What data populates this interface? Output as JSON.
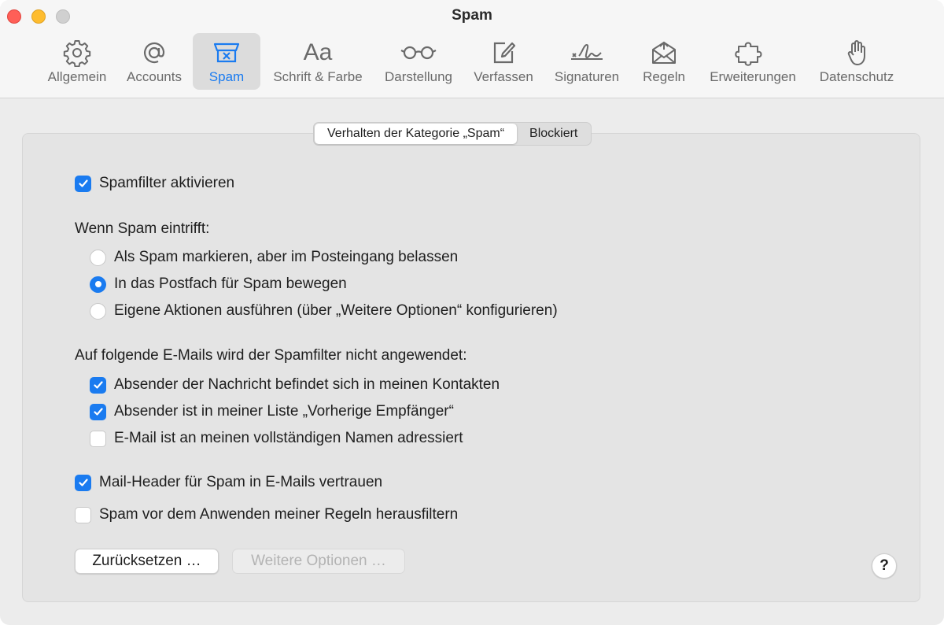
{
  "window": {
    "title": "Spam"
  },
  "toolbar": {
    "items": [
      {
        "label": "Allgemein",
        "icon": "gear-icon"
      },
      {
        "label": "Accounts",
        "icon": "at-sign-icon"
      },
      {
        "label": "Spam",
        "icon": "junk-tray-icon",
        "active": true
      },
      {
        "label": "Schrift & Farbe",
        "icon": "font-aa-icon"
      },
      {
        "label": "Darstellung",
        "icon": "glasses-icon"
      },
      {
        "label": "Verfassen",
        "icon": "compose-icon"
      },
      {
        "label": "Signaturen",
        "icon": "signature-icon"
      },
      {
        "label": "Regeln",
        "icon": "rules-envelope-icon"
      },
      {
        "label": "Erweiterungen",
        "icon": "puzzle-piece-icon"
      },
      {
        "label": "Datenschutz",
        "icon": "hand-icon"
      }
    ]
  },
  "segmented": {
    "tab1": "Verhalten der Kategorie „Spam“",
    "tab2": "Blockiert",
    "selected": "tab1"
  },
  "settings": {
    "enable_filter": {
      "label": "Spamfilter aktivieren",
      "checked": true
    },
    "when_spam_heading": "Wenn Spam eintrifft:",
    "radio_options": [
      {
        "label": "Als Spam markieren, aber im Posteingang belassen",
        "selected": false
      },
      {
        "label": "In das Postfach für Spam bewegen",
        "selected": true
      },
      {
        "label": "Eigene Aktionen ausführen (über „Weitere Optionen“ konfigurieren)",
        "selected": false
      }
    ],
    "exempt_heading": "Auf folgende E-Mails wird der Spamfilter nicht angewendet:",
    "exempt_options": [
      {
        "label": "Absender der Nachricht befindet sich in meinen Kontakten",
        "checked": true
      },
      {
        "label": "Absender ist in meiner Liste „Vorherige Empfänger“",
        "checked": true
      },
      {
        "label": "E-Mail ist an meinen vollständigen Namen adressiert",
        "checked": false
      }
    ],
    "trust_headers": {
      "label": "Mail-Header für Spam in E-Mails vertrauen",
      "checked": true
    },
    "filter_before_rules": {
      "label": "Spam vor dem Anwenden meiner Regeln herausfiltern",
      "checked": false
    }
  },
  "buttons": {
    "reset": "Zurücksetzen …",
    "more_options": "Weitere Optionen …",
    "help": "?"
  },
  "colors": {
    "accent": "#1a7bf0"
  }
}
